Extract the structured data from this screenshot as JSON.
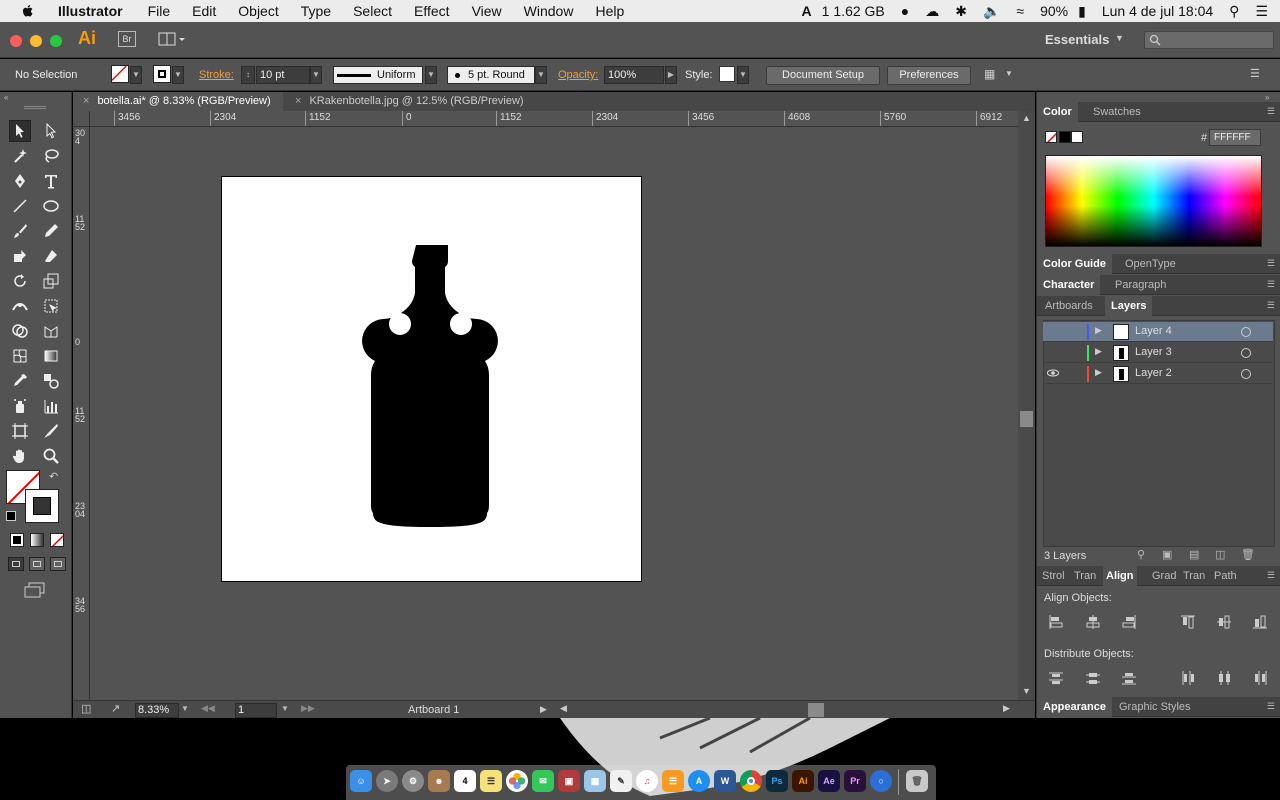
{
  "menubar": {
    "app_name": "Illustrator",
    "items": [
      "File",
      "Edit",
      "Object",
      "Type",
      "Select",
      "Effect",
      "View",
      "Window",
      "Help"
    ],
    "status": {
      "memory_prefix": "1",
      "memory": "1.62 GB",
      "battery": "90%",
      "datetime": "Lun 4 de jul  18:04"
    }
  },
  "appbar": {
    "logo": "Ai",
    "bridge": "Br",
    "workspace": "Essentials"
  },
  "controlbar": {
    "selection": "No Selection",
    "stroke_label": "Stroke:",
    "stroke_weight": "10 pt",
    "profile": "Uniform",
    "brush": "5 pt. Round",
    "opacity_label": "Opacity:",
    "opacity": "100%",
    "style_label": "Style:",
    "document_setup": "Document Setup",
    "preferences": "Preferences"
  },
  "tabs": [
    {
      "title": "botella.ai* @ 8.33% (RGB/Preview)",
      "active": true
    },
    {
      "title": "KRakenbotella.jpg @ 12.5% (RGB/Preview)",
      "active": false
    }
  ],
  "hruler": [
    "3456",
    "2304",
    "1152",
    "0",
    "1152",
    "2304",
    "3456",
    "4608",
    "5760",
    "6912"
  ],
  "vruler": [
    "304",
    "1152",
    "0",
    "1152",
    "2304",
    "3456"
  ],
  "statusbar": {
    "zoom": "8.33%",
    "page": "1",
    "artboard": "Artboard 1"
  },
  "panels": {
    "color_tabs": [
      "Color",
      "Swatches"
    ],
    "hex_label": "#",
    "hex": "FFFFFF",
    "guide_tabs": [
      "Color Guide",
      "OpenType"
    ],
    "char_tabs": [
      "Character",
      "Paragraph"
    ],
    "layer_tabs": [
      "Artboards",
      "Layers"
    ],
    "layers": [
      {
        "name": "Layer 4",
        "color": "#3c5cff",
        "selected": true,
        "visible": false
      },
      {
        "name": "Layer 3",
        "color": "#3ce65a",
        "selected": false,
        "visible": false
      },
      {
        "name": "Layer 2",
        "color": "#ff4040",
        "selected": false,
        "visible": true
      }
    ],
    "layer_count": "3 Layers",
    "align_tabs": [
      "Strol",
      "Tran",
      "Align",
      "Grad",
      "Tran",
      "Path"
    ],
    "align_objects": "Align Objects:",
    "distribute_objects": "Distribute Objects:",
    "appearance_tabs": [
      "Appearance",
      "Graphic Styles"
    ]
  },
  "dock": [
    "Finder",
    "Launchpad",
    "System Preferences",
    "Contacts",
    "Calendar",
    "Notes",
    "Photos",
    "Messages",
    "Photo Booth",
    "Preview",
    "TextEdit",
    "iTunes",
    "iBooks",
    "App Store",
    "Word",
    "Chrome",
    "Ps",
    "Ai",
    "Ae",
    "Pr",
    "Browser",
    "Trash"
  ]
}
